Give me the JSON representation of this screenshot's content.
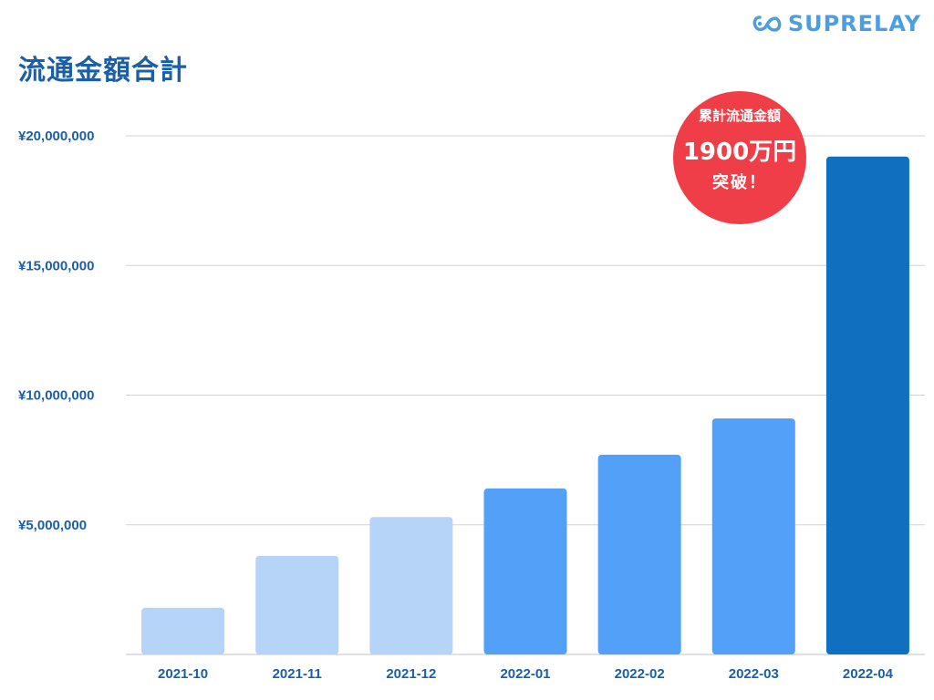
{
  "title": "流通金額合計",
  "logo": {
    "text": "SUPRELAY",
    "icon": "infinity-link-icon",
    "color": "#4d9ee0"
  },
  "badge": {
    "line1": "累計流通金額",
    "line2": "1900万円",
    "line3": "突破！",
    "color": "#ef3e47"
  },
  "chart_data": {
    "type": "bar",
    "categories": [
      "2021-10",
      "2021-11",
      "2021-12",
      "2022-01",
      "2022-02",
      "2022-03",
      "2022-04"
    ],
    "values": [
      1800000,
      3800000,
      5300000,
      6400000,
      7700000,
      9100000,
      19200000
    ],
    "bar_colors": [
      "#b6d4f7",
      "#b6d4f7",
      "#b6d4f7",
      "#52a0f8",
      "#52a0f8",
      "#52a0f8",
      "#116fbf"
    ],
    "ylim": [
      0,
      20000000
    ],
    "yticks": [
      5000000,
      10000000,
      15000000,
      20000000
    ],
    "ytick_labels": [
      "¥5,000,000",
      "¥10,000,000",
      "¥15,000,000",
      "¥20,000,000"
    ],
    "grid": true,
    "title": "流通金額合計",
    "xlabel": "",
    "ylabel": ""
  }
}
